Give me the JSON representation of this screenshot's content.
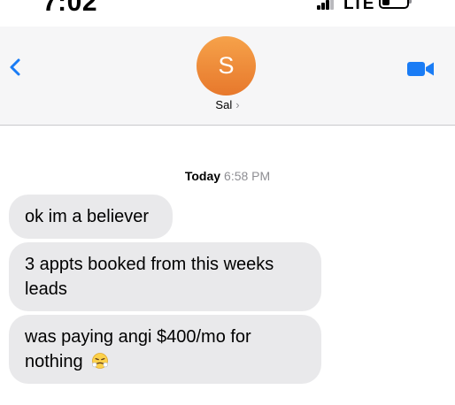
{
  "status_bar": {
    "time": "7:02",
    "network": "LTE"
  },
  "header": {
    "avatar_initial": "S",
    "contact_name": "Sal",
    "contact_chevron": "›",
    "icons": {
      "back": "chevron-left-icon",
      "video": "video-camera-icon"
    },
    "accent_color": "#1a7cf5"
  },
  "conversation": {
    "timestamp_day": "Today",
    "timestamp_time": "6:58 PM",
    "messages": [
      {
        "text": "ok im a believer"
      },
      {
        "text": "3 appts booked from this weeks leads"
      },
      {
        "text": "was paying angi $400/mo for nothing",
        "emoji": "face-with-steam-from-nose"
      }
    ]
  },
  "colors": {
    "bubble_gray": "#e9e9eb",
    "avatar_orange": "#ee8a35",
    "header_bg": "#f6f6f7"
  }
}
